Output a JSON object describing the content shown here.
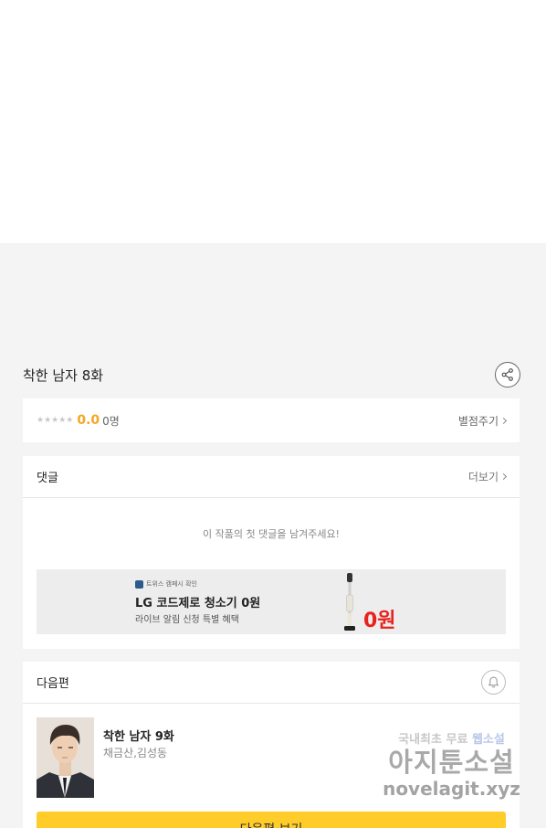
{
  "episode": {
    "title": "착한 남자 8화"
  },
  "rating": {
    "stars": "★★★★★",
    "score": "0.0",
    "count": "0명",
    "rate_link": "별점주기"
  },
  "comments": {
    "header": "댓글",
    "more_link": "더보기",
    "empty_message": "이 작품의 첫 댓글을 남겨주세요!"
  },
  "ad": {
    "badge": "트위스 캠페시 확인",
    "headline": "LG 코드제로 청소기 0원",
    "subline": "라이브 알림 신청 특별 혜택",
    "price": "0원"
  },
  "next_episode": {
    "header": "다음편",
    "title": "착한 남자 9화",
    "authors": "채금산,김성동",
    "button_label": "다음편 보기"
  },
  "watermark": {
    "line1_prefix": "국내최초 무료",
    "line1_highlight": "웹소설",
    "line2": "아지툰소설",
    "line3": "novelagit.xyz"
  },
  "colors": {
    "accent_score": "#f5a623",
    "next_button": "#ffcc29",
    "ad_price": "#e8221d"
  }
}
